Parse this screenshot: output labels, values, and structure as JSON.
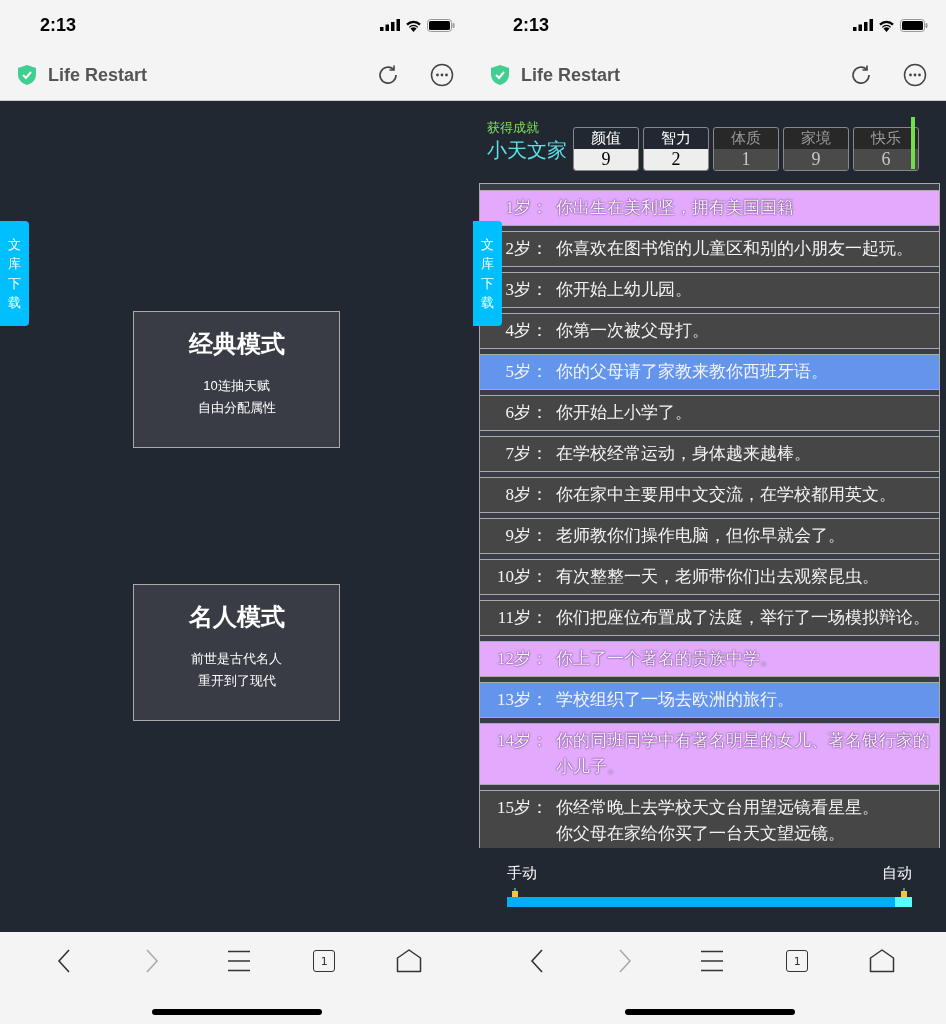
{
  "screens": [
    {
      "kind": "modes",
      "status_time": "2:13",
      "title": "Life Restart",
      "side_tab": "文库下载",
      "modes": [
        {
          "title": "经典模式",
          "lines": [
            "10连抽天赋",
            "自由分配属性"
          ]
        },
        {
          "title": "名人模式",
          "lines": [
            "前世是古代名人",
            "重开到了现代"
          ]
        }
      ],
      "nav": {
        "tab_count": "1",
        "forward_disabled": true
      }
    },
    {
      "kind": "game",
      "status_time": "2:13",
      "title": "Life Restart",
      "side_tab": "文库下载",
      "achievement": {
        "label": "获得成就",
        "name": "小天文家"
      },
      "properties": [
        {
          "label": "颜值",
          "value": "9",
          "dimmed": false
        },
        {
          "label": "智力",
          "value": "2",
          "dimmed": false
        },
        {
          "label": "体质",
          "value": "1",
          "dimmed": true
        },
        {
          "label": "家境",
          "value": "9",
          "dimmed": true
        },
        {
          "label": "快乐",
          "value": "6",
          "dimmed": true
        }
      ],
      "events": [
        {
          "age": "1岁：",
          "lines": [
            "你出生在美利坚，拥有美国国籍"
          ],
          "color": "#e2a9fd"
        },
        {
          "age": "2岁：",
          "lines": [
            "你喜欢在图书馆的儿童区和别的小朋友一起玩。"
          ],
          "color": "#464646"
        },
        {
          "age": "3岁：",
          "lines": [
            "你开始上幼儿园。"
          ],
          "color": "#464646"
        },
        {
          "age": "4岁：",
          "lines": [
            "你第一次被父母打。"
          ],
          "color": "#464646"
        },
        {
          "age": "5岁：",
          "lines": [
            "你的父母请了家教来教你西班牙语。"
          ],
          "color": "#6495ed"
        },
        {
          "age": "6岁：",
          "lines": [
            "你开始上小学了。"
          ],
          "color": "#464646"
        },
        {
          "age": "7岁：",
          "lines": [
            "在学校经常运动，身体越来越棒。"
          ],
          "color": "#464646"
        },
        {
          "age": "8岁：",
          "lines": [
            "你在家中主要用中文交流，在学校都用英文。"
          ],
          "color": "#464646"
        },
        {
          "age": "9岁：",
          "lines": [
            "老师教你们操作电脑，但你早就会了。"
          ],
          "color": "#464646"
        },
        {
          "age": "10岁：",
          "lines": [
            "有次整整一天，老师带你们出去观察昆虫。"
          ],
          "color": "#464646"
        },
        {
          "age": "11岁：",
          "lines": [
            "你们把座位布置成了法庭，举行了一场模拟辩论。"
          ],
          "color": "#464646"
        },
        {
          "age": "12岁：",
          "lines": [
            "你上了一个著名的贵族中学。"
          ],
          "color": "#e2a9fd"
        },
        {
          "age": "13岁：",
          "lines": [
            "学校组织了一场去欧洲的旅行。"
          ],
          "color": "#6495ed"
        },
        {
          "age": "14岁：",
          "lines": [
            "你的同班同学中有著名明星的女儿、著名银行家的小儿子。"
          ],
          "color": "#e2a9fd"
        },
        {
          "age": "15岁：",
          "lines": [
            "你经常晚上去学校天文台用望远镜看星星。",
            "你父母在家给你买了一台天文望远镜。"
          ],
          "color": "#464646"
        }
      ],
      "mode_slider": {
        "left": "手动",
        "right": "自动",
        "level": 1
      },
      "nav": {
        "tab_count": "1",
        "forward_disabled": true
      }
    }
  ]
}
